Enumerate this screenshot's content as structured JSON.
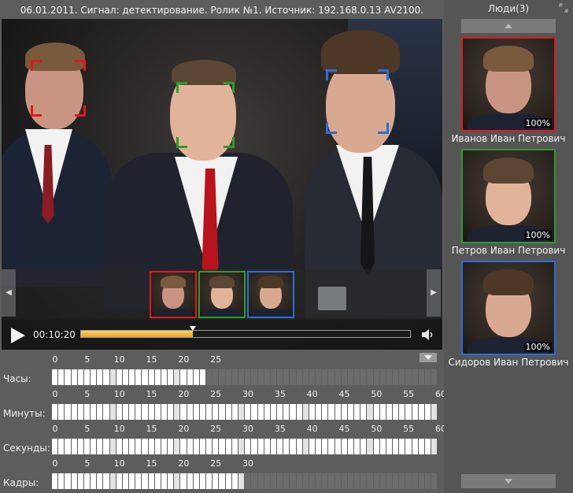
{
  "header": {
    "status_text": "06.01.2011. Сигнал: детектирование. Ролик №1. Источник: 192.168.0.13 AV2100."
  },
  "player": {
    "time": "00:10:20",
    "progress": 0.34,
    "strip_thumbs": [
      {
        "color": "#e0191b",
        "skin": "#c99582",
        "hair": "#7a5a3c"
      },
      {
        "color": "#2f9a2a",
        "skin": "#e1b399",
        "hair": "#5a4632"
      },
      {
        "color": "#2b6ed8",
        "skin": "#d9a890",
        "hair": "#4d3826"
      }
    ]
  },
  "faces": [
    {
      "color": "#e0191b"
    },
    {
      "color": "#2f9a2a"
    },
    {
      "color": "#2b6ed8"
    }
  ],
  "timeline": {
    "hours": {
      "label": "Часы:",
      "ticks": [
        "0",
        "5",
        "10",
        "15",
        "20",
        "25"
      ],
      "max": 24,
      "count": 60
    },
    "minutes": {
      "label": "Минуты:",
      "ticks": [
        "0",
        "5",
        "10",
        "15",
        "20",
        "25",
        "30",
        "35",
        "40",
        "45",
        "50",
        "55",
        "60"
      ],
      "max": 60,
      "count": 60
    },
    "seconds": {
      "label": "Секунды:",
      "ticks": [
        "0",
        "5",
        "10",
        "15",
        "20",
        "25",
        "30",
        "35",
        "40",
        "45",
        "50",
        "55",
        "60"
      ],
      "max": 60,
      "count": 60
    },
    "frames": {
      "label": "Кадры:",
      "ticks": [
        "0",
        "5",
        "10",
        "15",
        "20",
        "25",
        "30"
      ],
      "max": 30,
      "count": 60
    }
  },
  "sidebar": {
    "title": "Люди(3)",
    "people": [
      {
        "name": "Иванов Иван Петрович",
        "confidence": "100%",
        "color": "#e0191b",
        "skin": "#c99582",
        "hair": "#7a5a3c"
      },
      {
        "name": "Петров Иван Петрович",
        "confidence": "100%",
        "color": "#2f9a2a",
        "skin": "#e1b399",
        "hair": "#5a4632"
      },
      {
        "name": "Сидоров Иван Петрович",
        "confidence": "100%",
        "color": "#2b6ed8",
        "skin": "#d9a890",
        "hair": "#4d3826"
      }
    ]
  }
}
